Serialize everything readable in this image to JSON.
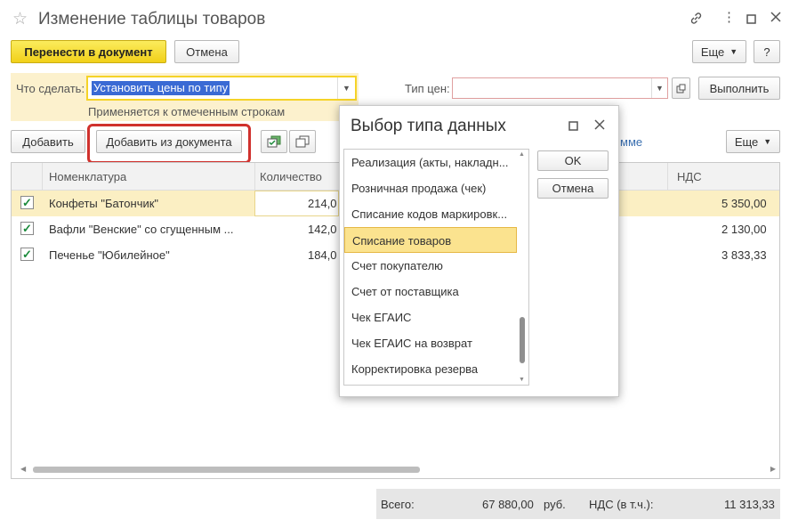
{
  "window": {
    "title": "Изменение таблицы товаров",
    "icons": [
      "star-icon",
      "link-icon",
      "more-icon",
      "maximize-icon",
      "close-icon"
    ]
  },
  "toolbar": {
    "transfer_label": "Перенести в документ",
    "cancel_label": "Отмена",
    "more_label": "Еще",
    "help_label": "?"
  },
  "action": {
    "label": "Что сделать:",
    "value": "Установить цены по типу",
    "hint": "Применяется к отмеченным строкам"
  },
  "price_type": {
    "label": "Тип цен:",
    "value": "",
    "execute_label": "Выполнить"
  },
  "table_toolbar": {
    "add_label": "Добавить",
    "add_from_doc_label": "Добавить из документа",
    "partial_link": "мме",
    "more_label": "Еще"
  },
  "table": {
    "columns": [
      "Номенклатура",
      "Количество",
      "НДС"
    ],
    "rows": [
      {
        "checked": true,
        "name": "Конфеты \"Батончик\"",
        "qty": "214,0",
        "vat": "5 350,00"
      },
      {
        "checked": true,
        "name": "Вафли \"Венские\" со сгущенным ...",
        "qty": "142,0",
        "vat": "2 130,00"
      },
      {
        "checked": true,
        "name": "Печенье \"Юбилейное\"",
        "qty": "184,0",
        "vat": "3 833,33"
      }
    ]
  },
  "totals": {
    "total_label": "Всего:",
    "total_value": "67 880,00",
    "currency": "руб.",
    "vat_label": "НДС (в т.ч.):",
    "vat_value": "11 313,33"
  },
  "dialog": {
    "title": "Выбор типа данных",
    "ok_label": "OK",
    "cancel_label": "Отмена",
    "items": [
      "Реализация (акты, накладн...",
      "Розничная продажа (чек)",
      "Списание кодов маркировк...",
      "Списание товаров",
      "Счет покупателю",
      "Счет от поставщика",
      "Чек ЕГАИС",
      "Чек ЕГАИС на возврат",
      "Корректировка резерва"
    ],
    "selected_index": 3
  },
  "colors": {
    "accent_yellow": "#f5d327",
    "highlight_red": "#d0312d",
    "selection_blue": "#3a6ad4"
  }
}
